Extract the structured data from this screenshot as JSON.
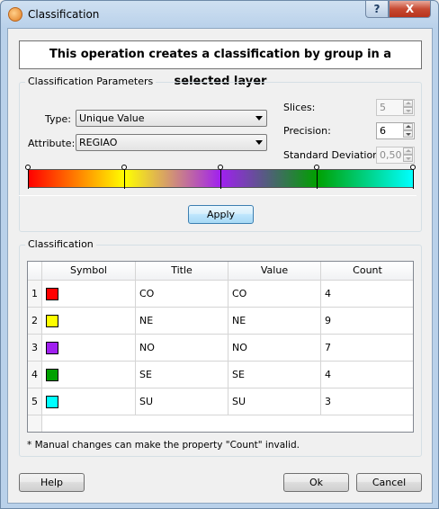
{
  "window": {
    "title": "Classification",
    "help_glyph": "?",
    "close_glyph": "X"
  },
  "banner": "This operation creates a classification by group in a selected layer",
  "parameters": {
    "group_title": "Classification Parameters",
    "type_label": "Type:",
    "type_value": "Unique Value",
    "attribute_label": "Attribute:",
    "attribute_value": "REGIAO",
    "slices_label": "Slices:",
    "slices_value": "5",
    "precision_label": "Precision:",
    "precision_value": "6",
    "stddev_label": "Standard Deviation:",
    "stddev_value": "0,50",
    "apply_label": "Apply",
    "ramp_colors": [
      "#ff0000",
      "#ffff00",
      "#a020f0",
      "#00a000",
      "#00ffff"
    ]
  },
  "classification": {
    "group_title": "Classification",
    "columns": [
      "Symbol",
      "Title",
      "Value",
      "Count"
    ],
    "rows": [
      {
        "num": "1",
        "color": "#ff0000",
        "title": "CO",
        "value": "CO",
        "count": "4"
      },
      {
        "num": "2",
        "color": "#ffff00",
        "title": "NE",
        "value": "NE",
        "count": "9"
      },
      {
        "num": "3",
        "color": "#a020f0",
        "title": "NO",
        "value": "NO",
        "count": "7"
      },
      {
        "num": "4",
        "color": "#00a000",
        "title": "SE",
        "value": "SE",
        "count": "4"
      },
      {
        "num": "5",
        "color": "#00ffff",
        "title": "SU",
        "value": "SU",
        "count": "3"
      }
    ],
    "note": "* Manual changes can make the property \"Count\" invalid."
  },
  "buttons": {
    "help": "Help",
    "ok": "Ok",
    "cancel": "Cancel"
  }
}
